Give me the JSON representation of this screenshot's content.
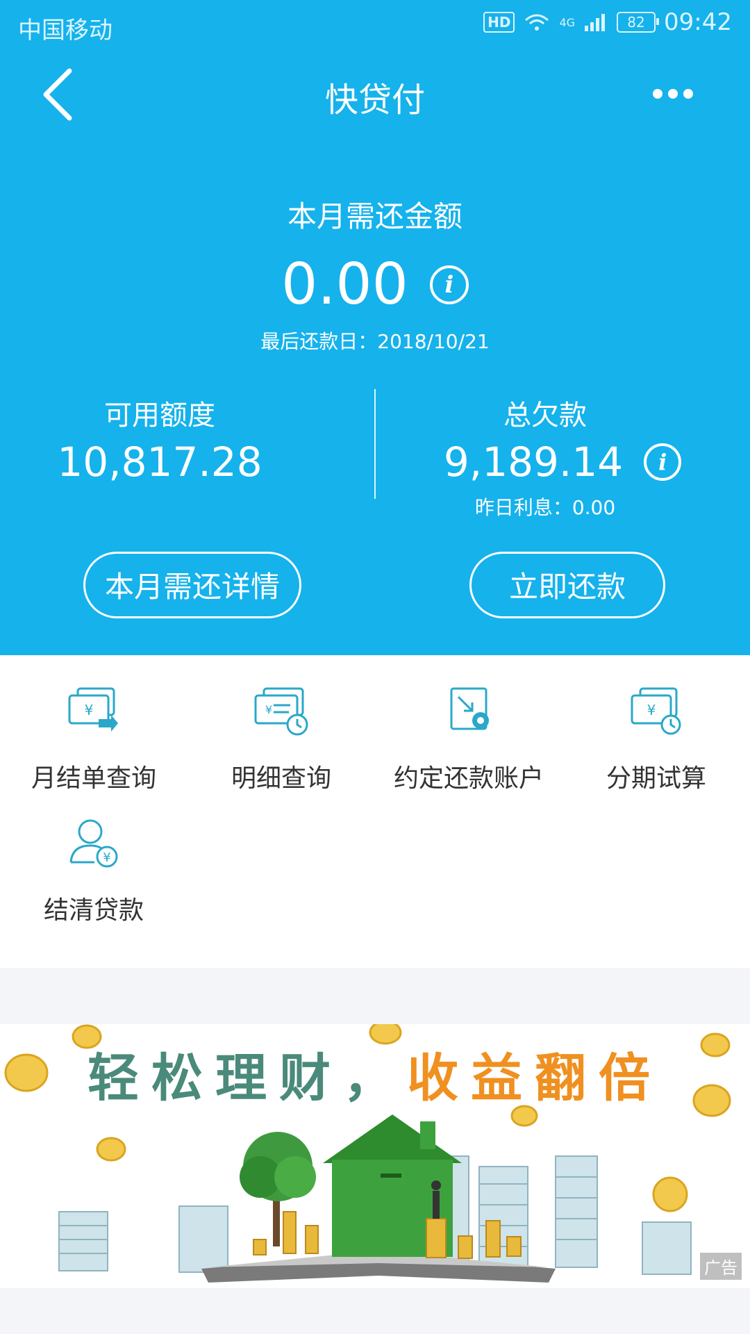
{
  "status_bar": {
    "carrier": "中国移动",
    "hd": "HD",
    "network": "4G",
    "battery": "82",
    "time": "09:42"
  },
  "navbar": {
    "title": "快贷付",
    "back_icon": "back-arrow-icon",
    "more_icon": "more-dots-icon"
  },
  "summary": {
    "due_label": "本月需还金额",
    "due_amount": "0.00",
    "due_date": "最后还款日：2018/10/21",
    "available_label": "可用额度",
    "available_value": "10,817.28",
    "total_owed_label": "总欠款",
    "total_owed_value": "9,189.14",
    "yesterday_interest": "昨日利息：0.00",
    "info_glyph": "i"
  },
  "actions": {
    "details_button": "本月需还详情",
    "repay_button": "立即还款"
  },
  "services": [
    {
      "label": "月结单查询",
      "icon": "monthly-statement-icon"
    },
    {
      "label": "明细查询",
      "icon": "transaction-details-icon"
    },
    {
      "label": "约定还款账户",
      "icon": "repayment-account-icon"
    },
    {
      "label": "分期试算",
      "icon": "installment-calculator-icon"
    },
    {
      "label": "结清贷款",
      "icon": "settle-loan-icon"
    }
  ],
  "banner": {
    "title_part1": "轻松理财，",
    "title_part2": "收益翻倍",
    "ad_tag": "广告"
  },
  "colors": {
    "primary": "#15b2ec",
    "icon": "#2aa8c9",
    "banner_green": "#4a8a7a",
    "banner_orange": "#f09020"
  }
}
